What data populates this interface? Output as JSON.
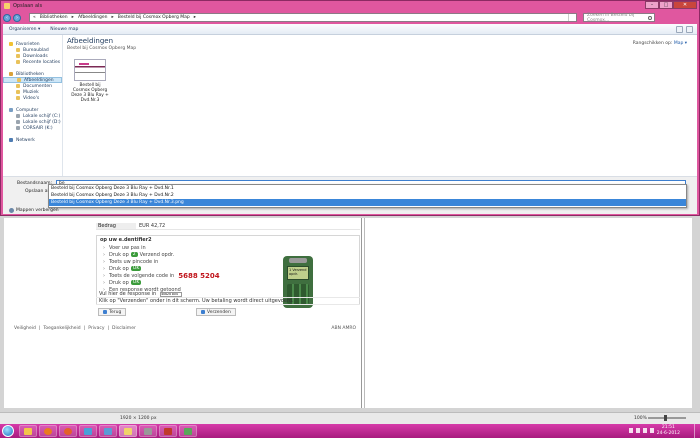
{
  "dialog": {
    "title": "Opslaan als",
    "address": {
      "crumbs": [
        "«",
        "Bibliotheken",
        "▸",
        "Afbeeldingen",
        "▸",
        "Besteld bij Cosmox Opberg Map",
        "▸"
      ]
    },
    "search_placeholder": "Zoeken in Besteld bij Cosmox...",
    "window_controls": {
      "minimize": "–",
      "maximize": "□",
      "close": "✕"
    },
    "toolbar": {
      "organize": "Organiseren ▾",
      "new_folder": "Nieuwe map"
    },
    "nav": {
      "favorites": {
        "header": "Favorieten",
        "items": [
          "Bureaublad",
          "Downloads",
          "Recente locaties"
        ]
      },
      "libraries": {
        "header": "Bibliotheken",
        "items": [
          "Afbeeldingen",
          "Documenten",
          "Muziek",
          "Video's"
        ]
      },
      "computer": {
        "header": "Computer",
        "items": [
          "Lokale schijf (C:)",
          "Lokale schijf (D:)",
          "CORSAIR (K:)"
        ]
      },
      "network": {
        "header": "Netwerk"
      }
    },
    "content": {
      "library_title": "Afbeeldingen",
      "library_sub": "Bestel bij Cosmox Opberg Map",
      "arrange_label": "Rangschikken op:",
      "arrange_value": "Map ▾",
      "file": {
        "name": "Bestell bij Cosmox Opberg Deze 3 Blu Ray + Dvd.Nr.3"
      }
    },
    "bottom": {
      "filename_label": "Bestandsnaam:",
      "filename_value": "be",
      "savetype_label": "Opslaan als:",
      "collapse_label": "Mappen verbergen"
    },
    "autocomplete": [
      "Besteld bij Cosmox Opberg Deze 3 Blu Ray + Dvd.Nr.1",
      "Besteld bij Cosmox Opberg Deze 3 Blu Ray + Dvd.Nr.2",
      "Besteld bij Cosmox Opberg Deze 3 Blu Ray + Dvd.Nr.3.png"
    ]
  },
  "page": {
    "rows": [
      {
        "k": "Bedrag",
        "v": "EUR   42,72"
      }
    ],
    "steps_title": "op uw e.dentifier2",
    "steps": [
      {
        "text": "Voer uw pas in"
      },
      {
        "text": "Druk op",
        "badge": "2",
        "after": "Verzend opdr."
      },
      {
        "text": "Toets uw pincode in"
      },
      {
        "text": "Druk op",
        "badge": "OK"
      },
      {
        "text": "Toets de volgende code in",
        "code": "5688 5204"
      },
      {
        "text": "Druk op",
        "badge": "OK"
      },
      {
        "text": "Een response wordt getoond"
      }
    ],
    "reader_screen": "1 Verzend opdr.",
    "response_label": "Vul hier de response in",
    "response_value": "40625 804",
    "response_note": "Klik op \"Verzenden\" onder in dit scherm. Uw betaling wordt direct uitgevoerd.",
    "btn_back": "Terug",
    "btn_send": "Verzenden",
    "footer": [
      "Veiligheid",
      "|",
      "Toegankelijkheid",
      "|",
      "Privacy",
      "|",
      "Disclaimer"
    ],
    "footer_brand": "ABN AMRO"
  },
  "statusbar": {
    "dims": "1920 × 1200 px",
    "zoom": "100%"
  },
  "taskbar": {
    "time": "21:51",
    "date": "24-6-2012"
  }
}
